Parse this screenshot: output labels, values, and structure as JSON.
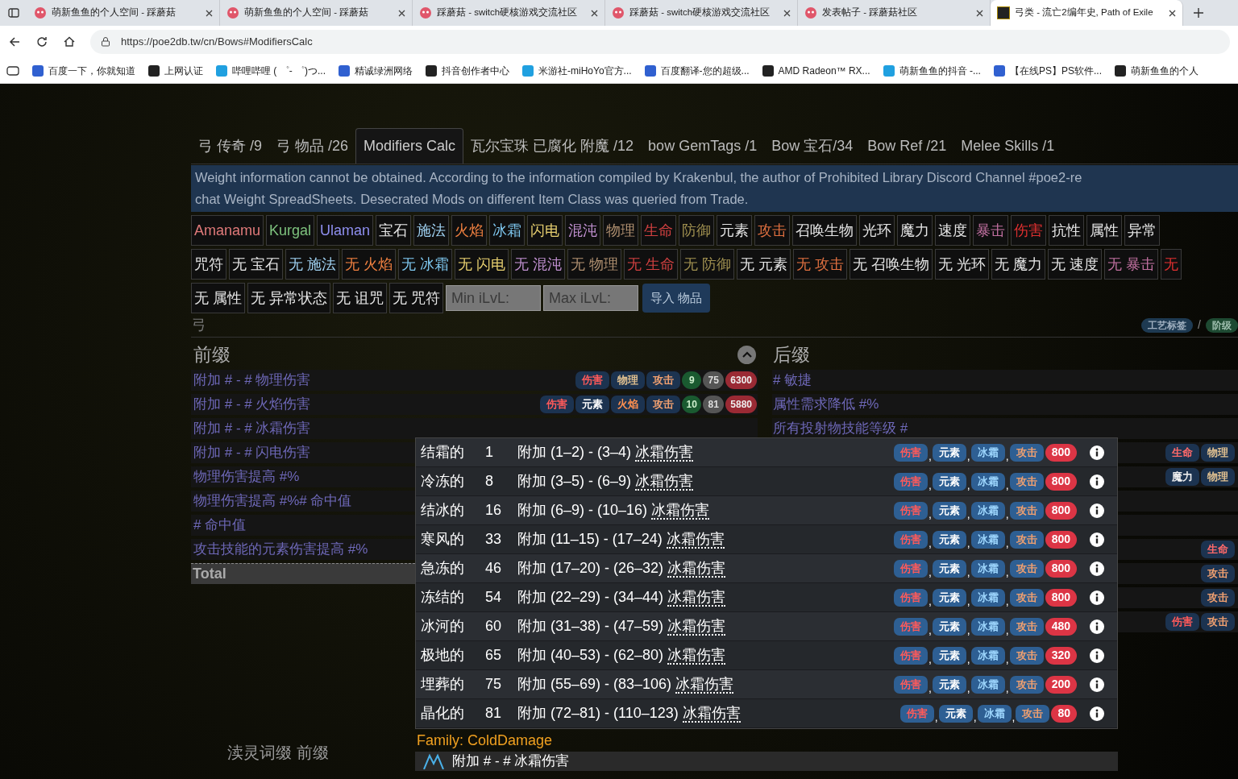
{
  "browser": {
    "tabs": [
      {
        "title": "萌新鱼鱼的个人空间 - 踩蘑菇",
        "selected": false
      },
      {
        "title": "萌新鱼鱼的个人空间 - 踩蘑菇",
        "selected": false
      },
      {
        "title": "踩蘑菇 - switch硬核游戏交流社区",
        "selected": false
      },
      {
        "title": "踩蘑菇 - switch硬核游戏交流社区",
        "selected": false
      },
      {
        "title": "发表帖子 - 踩蘑菇社区",
        "selected": false
      },
      {
        "title": "弓类 - 流亡2编年史, Path of Exile",
        "selected": true
      }
    ],
    "url": "https://poe2db.tw/cn/Bows#ModifiersCalc",
    "bookmarks": [
      "百度一下，你就知道",
      "上网认证",
      "哔哩哔哩 ( ゜- ゜)つ...",
      "精诚绿洲网络",
      "抖音创作者中心",
      "米游社-miHoYo官方...",
      "百度翻译-您的超级...",
      "AMD Radeon™ RX...",
      "萌新鱼鱼的抖音 -...",
      "【在线PS】PS软件...",
      "萌新鱼鱼的个人"
    ]
  },
  "nav_tabs": [
    {
      "label": "弓 传奇 /9",
      "selected": false
    },
    {
      "label": "弓 物品 /26",
      "selected": false
    },
    {
      "label": "Modifiers Calc",
      "selected": true
    },
    {
      "label": "瓦尔宝珠 已腐化 附魔 /12",
      "selected": false
    },
    {
      "label": "bow GemTags /1",
      "selected": false
    },
    {
      "label": "Bow 宝石/34",
      "selected": false
    },
    {
      "label": "Bow Ref /21",
      "selected": false
    },
    {
      "label": "Melee Skills /1",
      "selected": false
    }
  ],
  "notice": [
    "Weight information cannot be obtained. According to the information compiled by Krakenbul, the author of Prohibited Library Discord Channel #poe2-re",
    "chat Weight SpreadSheets. Desecrated Mods on different Item Class was queried from Trade."
  ],
  "tag_rows": [
    [
      {
        "label": "Amanamu",
        "color": "#e07a7a"
      },
      {
        "label": "Kurgal",
        "color": "#7ec27e"
      },
      {
        "label": "Ulaman",
        "color": "#8f8ff0"
      },
      {
        "label": "宝石",
        "color": "#e6e6e6"
      },
      {
        "label": "施法",
        "color": "#9fd0f0"
      },
      {
        "label": "火焰",
        "color": "#f08040"
      },
      {
        "label": "冰霜",
        "color": "#7fc8f0"
      },
      {
        "label": "闪电",
        "color": "#e8d070"
      },
      {
        "label": "混沌",
        "color": "#c090d0"
      },
      {
        "label": "物理",
        "color": "#b09070"
      },
      {
        "label": "生命",
        "color": "#d04040"
      },
      {
        "label": "防御",
        "color": "#a09050"
      },
      {
        "label": "元素",
        "color": "#e6e6e6"
      },
      {
        "label": "攻击",
        "color": "#e07040"
      },
      {
        "label": "召唤生物",
        "color": "#e6e6e6"
      },
      {
        "label": "光环",
        "color": "#e6e6e6"
      },
      {
        "label": "魔力",
        "color": "#e6e6e6"
      },
      {
        "label": "速度",
        "color": "#e6e6e6"
      },
      {
        "label": "暴击",
        "color": "#c070a0"
      },
      {
        "label": "伤害",
        "color": "#e03030"
      },
      {
        "label": "抗性",
        "color": "#e6e6e6"
      },
      {
        "label": "属性",
        "color": "#e6e6e6"
      },
      {
        "label": "异常",
        "color": "#e6e6e6"
      }
    ],
    [
      {
        "label": "咒符",
        "color": "#e6e6e6"
      },
      {
        "label": "无 宝石",
        "color": "#e6e6e6"
      },
      {
        "label": "无 施法",
        "color": "#9fd0f0"
      },
      {
        "label": "无 火焰",
        "color": "#f08040"
      },
      {
        "label": "无 冰霜",
        "color": "#7fc8f0"
      },
      {
        "label": "无 闪电",
        "color": "#e8d070"
      },
      {
        "label": "无 混沌",
        "color": "#c090d0"
      },
      {
        "label": "无 物理",
        "color": "#b09070"
      },
      {
        "label": "无 生命",
        "color": "#d04040"
      },
      {
        "label": "无 防御",
        "color": "#a09050"
      },
      {
        "label": "无 元素",
        "color": "#e6e6e6"
      },
      {
        "label": "无 攻击",
        "color": "#e07040"
      },
      {
        "label": "无 召唤生物",
        "color": "#e6e6e6"
      },
      {
        "label": "无 光环",
        "color": "#e6e6e6"
      },
      {
        "label": "无 魔力",
        "color": "#e6e6e6"
      },
      {
        "label": "无 速度",
        "color": "#e6e6e6"
      },
      {
        "label": "无 暴击",
        "color": "#c070a0"
      },
      {
        "label": "无",
        "color": "#e03030"
      }
    ],
    [
      {
        "label": "无 属性",
        "color": "#e6e6e6"
      },
      {
        "label": "无 异常状态",
        "color": "#e6e6e6"
      },
      {
        "label": "无 诅咒",
        "color": "#e6e6e6"
      },
      {
        "label": "无 咒符",
        "color": "#e6e6e6"
      }
    ]
  ],
  "min_ilvl": {
    "placeholder": "Min iLvL:"
  },
  "max_ilvl": {
    "placeholder": "Max iLvL:"
  },
  "import_button": "导入 物品",
  "section_label": "弓",
  "legend": {
    "craft_tags": "工艺标签",
    "separator": "/",
    "tier": "阶级"
  },
  "prefix": {
    "title": "前缀",
    "expanded": true,
    "rows": [
      {
        "text": "附加 # - # 物理伤害",
        "tags": [
          {
            "label": "伤害",
            "kind": "damage"
          },
          {
            "label": "物理",
            "kind": "physical"
          },
          {
            "label": "攻击",
            "kind": "attack"
          }
        ],
        "level": "9",
        "ilvl": "75",
        "weight": "6300"
      },
      {
        "text": "附加 # - # 火焰伤害",
        "tags": [
          {
            "label": "伤害",
            "kind": "damage"
          },
          {
            "label": "元素",
            "kind": "element"
          },
          {
            "label": "火焰",
            "kind": "fire"
          },
          {
            "label": "攻击",
            "kind": "attack"
          }
        ],
        "level": "10",
        "ilvl": "81",
        "weight": "5880"
      },
      {
        "text": "附加 # - # 冰霜伤害"
      },
      {
        "text": "附加 # - # 闪电伤害"
      },
      {
        "text": "物理伤害提高 #%"
      },
      {
        "text": "物理伤害提高 #%# 命中值"
      },
      {
        "text": "# 命中值"
      },
      {
        "text": "攻击技能的元素伤害提高 #%"
      }
    ],
    "total": "Total"
  },
  "suffix": {
    "title": "后缀",
    "rows": [
      {
        "text": "# 敏捷"
      },
      {
        "text": "属性需求降低 #%"
      },
      {
        "text": "所有投射物技能等级 #"
      },
      {
        "tags": [
          {
            "label": "生命",
            "kind": "life"
          },
          {
            "label": "物理",
            "kind": "physical"
          }
        ]
      },
      {
        "tags": [
          {
            "label": "魔力",
            "kind": "mana"
          },
          {
            "label": "物理",
            "kind": "physical"
          }
        ]
      },
      {},
      {},
      {
        "tags": [
          {
            "label": "生命",
            "kind": "life"
          }
        ]
      },
      {
        "tags": [
          {
            "label": "攻击",
            "kind": "attack"
          }
        ]
      },
      {
        "tags": [
          {
            "label": "攻击",
            "kind": "attack"
          }
        ]
      },
      {
        "tags": [
          {
            "label": "伤害",
            "kind": "damage"
          },
          {
            "label": "攻击",
            "kind": "attack"
          }
        ]
      }
    ]
  },
  "popup": {
    "rows": [
      {
        "name": "结霜的",
        "level": "1",
        "stat": "附加 (1–2) - (3–4)",
        "term": "冰霜伤害",
        "tags": [
          {
            "label": "伤害",
            "kind": "damage",
            "sep": ","
          },
          {
            "label": "元素",
            "kind": "element",
            "sep": ","
          },
          {
            "label": "冰霜",
            "kind": "cold",
            "sep": ","
          },
          {
            "label": "攻击",
            "kind": "attack"
          }
        ],
        "weight": "800"
      },
      {
        "name": "冷冻的",
        "level": "8",
        "stat": "附加 (3–5) - (6–9)",
        "term": "冰霜伤害",
        "tags": [
          {
            "label": "伤害",
            "kind": "damage",
            "sep": ","
          },
          {
            "label": "元素",
            "kind": "element",
            "sep": ","
          },
          {
            "label": "冰霜",
            "kind": "cold",
            "sep": ","
          },
          {
            "label": "攻击",
            "kind": "attack"
          }
        ],
        "weight": "800"
      },
      {
        "name": "结冰的",
        "level": "16",
        "stat": "附加 (6–9) - (10–16)",
        "term": "冰霜伤害",
        "tags": [
          {
            "label": "伤害",
            "kind": "damage",
            "sep": ","
          },
          {
            "label": "元素",
            "kind": "element",
            "sep": ","
          },
          {
            "label": "冰霜",
            "kind": "cold",
            "sep": ","
          },
          {
            "label": "攻击",
            "kind": "attack"
          }
        ],
        "weight": "800"
      },
      {
        "name": "寒风的",
        "level": "33",
        "stat": "附加 (11–15) - (17–24)",
        "term": "冰霜伤害",
        "tags": [
          {
            "label": "伤害",
            "kind": "damage",
            "sep": ","
          },
          {
            "label": "元素",
            "kind": "element",
            "sep": ","
          },
          {
            "label": "冰霜",
            "kind": "cold",
            "sep": ","
          },
          {
            "label": "攻击",
            "kind": "attack"
          }
        ],
        "weight": "800"
      },
      {
        "name": "急冻的",
        "level": "46",
        "stat": "附加 (17–20) - (26–32)",
        "term": "冰霜伤害",
        "tags": [
          {
            "label": "伤害",
            "kind": "damage",
            "sep": ","
          },
          {
            "label": "元素",
            "kind": "element",
            "sep": ","
          },
          {
            "label": "冰霜",
            "kind": "cold",
            "sep": ","
          },
          {
            "label": "攻击",
            "kind": "attack"
          }
        ],
        "weight": "800"
      },
      {
        "name": "冻结的",
        "level": "54",
        "stat": "附加 (22–29) - (34–44)",
        "term": "冰霜伤害",
        "tags": [
          {
            "label": "伤害",
            "kind": "damage",
            "sep": ","
          },
          {
            "label": "元素",
            "kind": "element",
            "sep": ","
          },
          {
            "label": "冰霜",
            "kind": "cold",
            "sep": ","
          },
          {
            "label": "攻击",
            "kind": "attack"
          }
        ],
        "weight": "800"
      },
      {
        "name": "冰河的",
        "level": "60",
        "stat": "附加 (31–38) - (47–59)",
        "term": "冰霜伤害",
        "tags": [
          {
            "label": "伤害",
            "kind": "damage",
            "sep": ","
          },
          {
            "label": "元素",
            "kind": "element",
            "sep": ","
          },
          {
            "label": "冰霜",
            "kind": "cold",
            "sep": ","
          },
          {
            "label": "攻击",
            "kind": "attack"
          }
        ],
        "weight": "480"
      },
      {
        "name": "极地的",
        "level": "65",
        "stat": "附加 (40–53) - (62–80)",
        "term": "冰霜伤害",
        "tags": [
          {
            "label": "伤害",
            "kind": "damage",
            "sep": ","
          },
          {
            "label": "元素",
            "kind": "element",
            "sep": ","
          },
          {
            "label": "冰霜",
            "kind": "cold",
            "sep": ","
          },
          {
            "label": "攻击",
            "kind": "attack"
          }
        ],
        "weight": "320"
      },
      {
        "name": "埋葬的",
        "level": "75",
        "stat": "附加 (55–69) - (83–106)",
        "term": "冰霜伤害",
        "tags": [
          {
            "label": "伤害",
            "kind": "damage",
            "sep": ","
          },
          {
            "label": "元素",
            "kind": "element",
            "sep": ","
          },
          {
            "label": "冰霜",
            "kind": "cold",
            "sep": ","
          },
          {
            "label": "攻击",
            "kind": "attack"
          }
        ],
        "weight": "200"
      },
      {
        "name": "晶化的",
        "level": "81",
        "stat": "附加 (72–81) - (110–123)",
        "term": "冰霜伤害",
        "tags": [
          {
            "label": "伤害",
            "kind": "damage",
            "sep": ","
          },
          {
            "label": "元素",
            "kind": "element",
            "sep": ","
          },
          {
            "label": "冰霜",
            "kind": "cold",
            "sep": ","
          },
          {
            "label": "攻击",
            "kind": "attack"
          }
        ],
        "weight": "80"
      }
    ],
    "family": "Family: ColdDamage",
    "preview": "附加 # - # 冰霜伤害"
  },
  "desecrated_heading": "渎灵词缀 前缀"
}
